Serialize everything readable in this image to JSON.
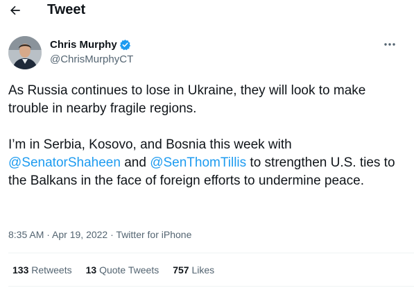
{
  "header": {
    "title": "Tweet",
    "back_icon": "back-arrow-icon"
  },
  "author": {
    "name": "Chris Murphy",
    "handle": "@ChrisMurphyCT",
    "verified_icon": "verified-badge-icon",
    "more_icon": "more-dots-icon"
  },
  "tweet": {
    "para1": "As Russia continues to lose in Ukraine, they will look to make trouble in nearby fragile regions.",
    "para2_pre": "I’m in Serbia, Kosovo, and Bosnia this week with ",
    "mention1": "@SenatorShaheen",
    "para2_mid": " and ",
    "mention2": "@SenThomTillis",
    "para2_post": " to strengthen U.S. ties to the Balkans in the face of foreign efforts to undermine peace."
  },
  "meta": {
    "time": "8:35 AM",
    "sep1": " · ",
    "date": "Apr 19, 2022",
    "sep2": " · ",
    "source": "Twitter for iPhone"
  },
  "stats": {
    "retweets_count": "133",
    "retweets_label": "Retweets",
    "quotes_count": "13",
    "quotes_label": "Quote Tweets",
    "likes_count": "757",
    "likes_label": "Likes"
  },
  "colors": {
    "link": "#1d9bf0",
    "text": "#0f1419",
    "secondary": "#536471"
  }
}
